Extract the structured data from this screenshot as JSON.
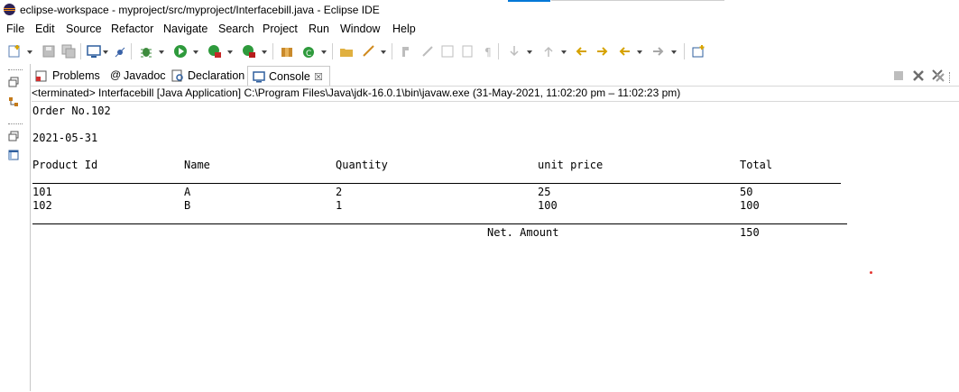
{
  "window": {
    "title": "eclipse-workspace - myproject/src/myproject/Interfacebill.java - Eclipse IDE"
  },
  "menu": [
    "File",
    "Edit",
    "Source",
    "Refactor",
    "Navigate",
    "Search",
    "Project",
    "Run",
    "Window",
    "Help"
  ],
  "tabs": [
    {
      "label": "Problems",
      "icon": "problems-icon"
    },
    {
      "label": "Javadoc",
      "icon": "javadoc-icon"
    },
    {
      "label": "Declaration",
      "icon": "declaration-icon"
    },
    {
      "label": "Console",
      "icon": "console-icon",
      "active": true,
      "close": "☒"
    }
  ],
  "console": {
    "status": "<terminated> Interfacebill [Java Application] C:\\Program Files\\Java\\jdk-16.0.1\\bin\\javaw.exe  (31-May-2021, 11:02:20 pm – 11:02:23 pm)",
    "order": "Order No.102",
    "date": "2021-05-31",
    "headers": [
      "Product Id",
      "Name",
      "Quantity",
      "unit price",
      "Total"
    ],
    "rows": [
      [
        "101",
        "A",
        "2",
        "25",
        "50"
      ],
      [
        "102",
        "B",
        "1",
        "100",
        "100"
      ]
    ],
    "net_label": "Net. Amount",
    "net_value": "150"
  },
  "colors": {
    "accent": "#0078d7",
    "brand_orange": "#f7941e",
    "brand_purple": "#2c2255",
    "run_green": "#2e9a3c"
  }
}
